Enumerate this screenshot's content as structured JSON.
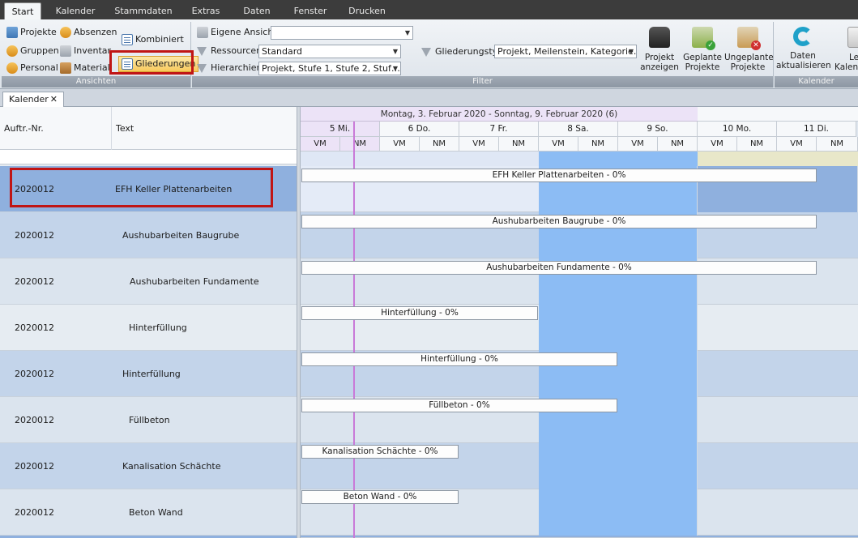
{
  "menu": {
    "tabs": [
      "Start",
      "Kalender",
      "Stammdaten",
      "Extras",
      "Daten",
      "Fenster",
      "Drucken"
    ]
  },
  "ribbon": {
    "ansichten": {
      "label": "Ansichten",
      "projekte": "Projekte",
      "absenzen": "Absenzen",
      "kombiniert": "Kombiniert",
      "gruppen": "Gruppen",
      "inventar": "Inventar",
      "personal": "Personal",
      "material": "Material",
      "gliederungen": "Gliederungen"
    },
    "filter": {
      "label": "Filter",
      "eigene_ansicht": "Eigene Ansicht",
      "eigene_ansicht_value": "",
      "ressourcen": "Ressourcen",
      "ressourcen_value": "Standard",
      "hierarchien": "Hierarchien",
      "hierarchien_value": "Projekt, Stufe 1, Stufe 2, Stuf…",
      "gliederungstyp": "Gliederungstyp",
      "gliederungstyp_value": "Projekt, Meilenstein, Kategorie…",
      "projekt_anzeigen_1": "Projekt",
      "projekt_anzeigen_2": "anzeigen",
      "geplante_1": "Geplante",
      "geplante_2": "Projekte",
      "ungeplante_1": "Ungeplante",
      "ungeplante_2": "Projekte"
    },
    "kalender": {
      "label": "Kalender",
      "daten_1": "Daten",
      "daten_2": "aktualisieren",
      "partial_1": "Le",
      "partial_2": "Kalend"
    }
  },
  "doc_tab": {
    "label": "Kalender",
    "close": "✕"
  },
  "grid": {
    "col_nr": "Auftr.-Nr.",
    "col_text": "Text",
    "rows": [
      {
        "nr": "2020012",
        "text": "EFH Keller Plattenarbeiten"
      },
      {
        "nr": "2020012",
        "text": "Aushubarbeiten Baugrube"
      },
      {
        "nr": "2020012",
        "text": "Aushubarbeiten Fundamente"
      },
      {
        "nr": "2020012",
        "text": "Hinterfüllung"
      },
      {
        "nr": "2020012",
        "text": "Hinterfüllung"
      },
      {
        "nr": "2020012",
        "text": "Füllbeton"
      },
      {
        "nr": "2020012",
        "text": "Kanalisation Schächte"
      },
      {
        "nr": "2020012",
        "text": "Beton Wand"
      }
    ]
  },
  "calendar": {
    "week_label": "Montag, 3. Februar 2020 - Sonntag, 9. Februar 2020 (6)",
    "days": [
      "5 Mi.",
      "6 Do.",
      "7 Fr.",
      "8 Sa.",
      "9 So.",
      "10 Mo.",
      "11 Di."
    ],
    "halves": [
      "VM",
      "NM"
    ],
    "bars": [
      "EFH Keller Plattenarbeiten - 0%",
      "Aushubarbeiten Baugrube - 0%",
      "Aushubarbeiten Fundamente - 0%",
      "Hinterfüllung - 0%",
      "Hinterfüllung - 0%",
      "Füllbeton - 0%",
      "Kanalisation Schächte - 0%",
      "Beton Wand - 0%"
    ]
  },
  "colors": {
    "selected_row": "#8fb0de",
    "weekend": "#8cbcf4",
    "highlight_border": "#c01515",
    "today_line": "#c97ad8"
  }
}
